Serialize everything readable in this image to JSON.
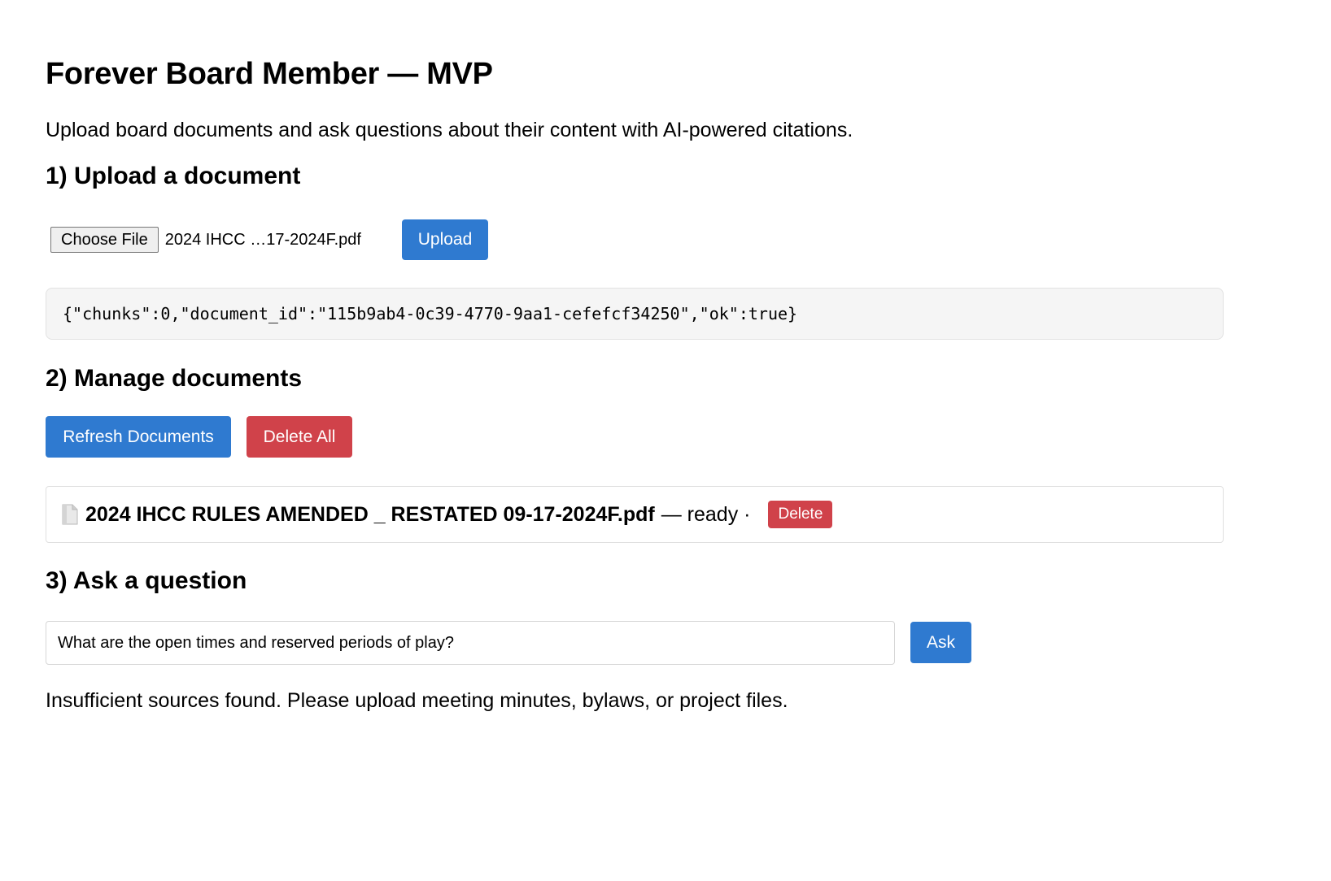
{
  "header": {
    "title": "Forever Board Member — MVP",
    "subtitle": "Upload board documents and ask questions about their content with AI-powered citations."
  },
  "upload": {
    "heading": "1) Upload a document",
    "choose_file_label": "Choose File",
    "selected_file": "2024 IHCC …17-2024F.pdf",
    "upload_button": "Upload",
    "result": "{\"chunks\":0,\"document_id\":\"115b9ab4-0c39-4770-9aa1-cefefcf34250\",\"ok\":true}"
  },
  "manage": {
    "heading": "2) Manage documents",
    "refresh_button": "Refresh Documents",
    "delete_all_button": "Delete All",
    "documents": [
      {
        "name": "2024 IHCC RULES AMENDED _ RESTATED 09-17-2024F.pdf",
        "status": "— ready ·",
        "delete_label": "Delete",
        "icon": "document-icon"
      }
    ]
  },
  "ask": {
    "heading": "3) Ask a question",
    "question_value": "What are the open times and reserved periods of play?",
    "ask_button": "Ask",
    "answer": "Insufficient sources found. Please upload meeting minutes, bylaws, or project files."
  },
  "colors": {
    "primary": "#2f7ad0",
    "danger": "#d0424a",
    "result_bg": "#f5f5f5"
  }
}
